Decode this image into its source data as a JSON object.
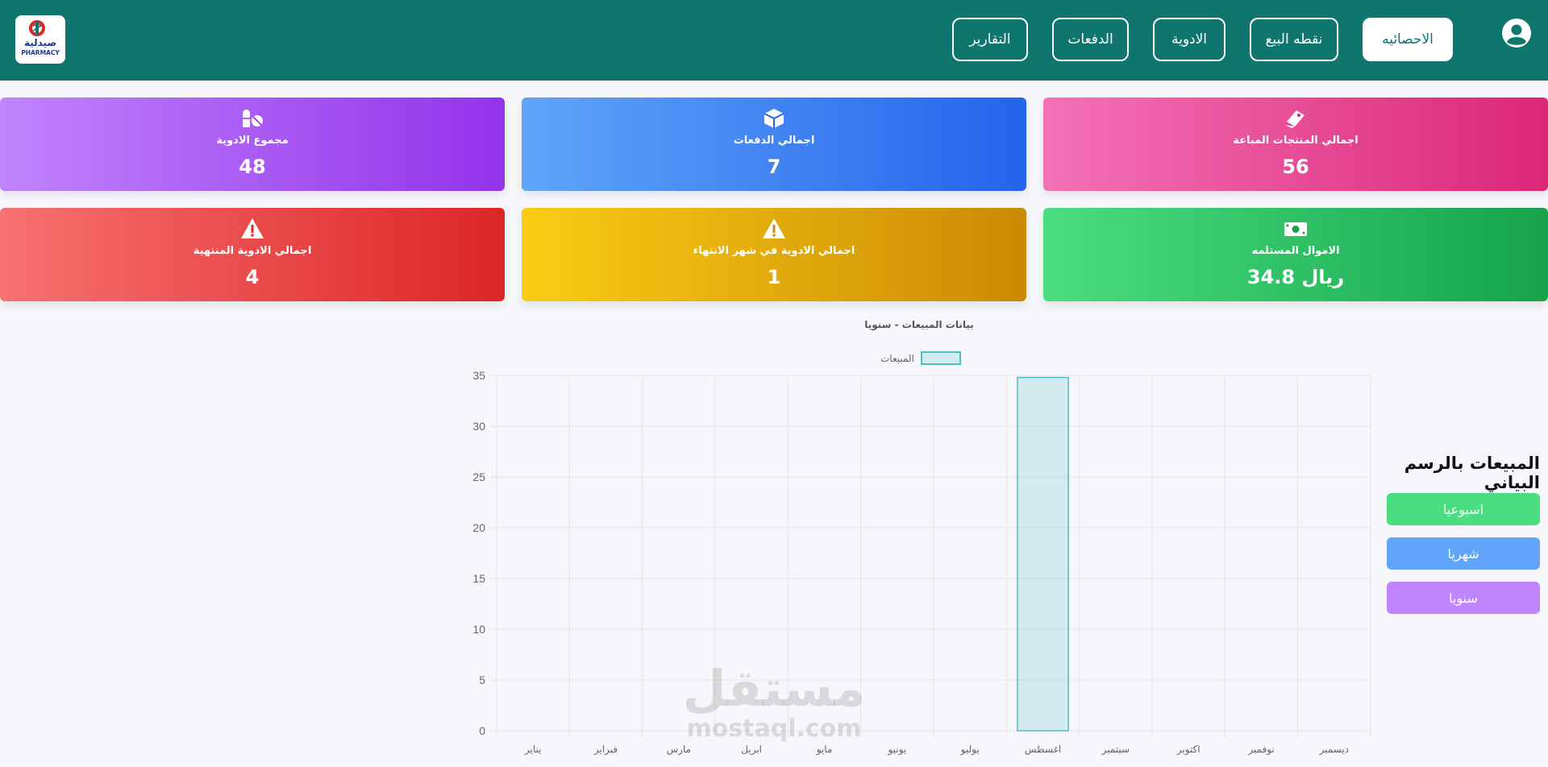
{
  "header": {
    "nav": [
      {
        "label": "الاحصائيه",
        "active": true
      },
      {
        "label": "نقطه البيع",
        "active": false
      },
      {
        "label": "الادوية",
        "active": false
      },
      {
        "label": "الدفعات",
        "active": false
      },
      {
        "label": "التقارير",
        "active": false
      }
    ],
    "logo": {
      "arabic": "صيدلية",
      "english": "PHARMACY"
    },
    "colors": {
      "bar": "#0f766e"
    }
  },
  "cards": [
    {
      "label": "اجمالي المنتجات المباعة",
      "value": "56",
      "icon": "tag-icon",
      "gradient": [
        "#f472b6",
        "#db2777"
      ]
    },
    {
      "label": "اجمالي الدفعات",
      "value": "7",
      "icon": "box-icon",
      "gradient": [
        "#60a5fa",
        "#2563eb"
      ]
    },
    {
      "label": "مجموع الادوية",
      "value": "48",
      "icon": "pills-icon",
      "gradient": [
        "#c084fc",
        "#9333ea"
      ]
    },
    {
      "label": "الاموال المستلمه",
      "value": "34.8 ريال",
      "icon": "money-icon",
      "gradient": [
        "#4ade80",
        "#16a34a"
      ]
    },
    {
      "label": "اجمالي الادوية في شهر الانتهاء",
      "value": "1",
      "icon": "warning-icon",
      "gradient": [
        "#facc15",
        "#ca8a04"
      ]
    },
    {
      "label": "اجمالي الادوية المنتهية",
      "value": "4",
      "icon": "warning-icon",
      "gradient": [
        "#f87171",
        "#dc2626"
      ]
    }
  ],
  "panel": {
    "title": "المبيعات بالرسم البياني",
    "buttons": [
      {
        "label": "اسبوعيا",
        "color": "#4ade80"
      },
      {
        "label": "شهريا",
        "color": "#60a5fa"
      },
      {
        "label": "سنويا",
        "color": "#c084fc"
      }
    ]
  },
  "watermark": {
    "line1": "مستقل",
    "line2": "mostaql.com"
  },
  "chart_data": {
    "type": "bar",
    "title": "بيانات المبيعات - سنويا",
    "categories": [
      "يناير",
      "فبراير",
      "مارس",
      "ابريل",
      "مايو",
      "يونيو",
      "يوليو",
      "اغسطس",
      "سبتمبر",
      "اكتوبر",
      "نوفمبر",
      "ديسمبر"
    ],
    "series": [
      {
        "name": "المبيعات",
        "values": [
          0,
          0,
          0,
          0,
          0,
          0,
          0,
          34.8,
          0,
          0,
          0,
          0
        ]
      }
    ],
    "ylim": [
      0,
      35
    ],
    "yticks": [
      0,
      5,
      10,
      15,
      20,
      25,
      30,
      35
    ],
    "grid": true,
    "legend": "top",
    "colors": {
      "fill": "rgba(75,192,192,0.2)",
      "stroke": "#4bc0c0"
    }
  }
}
